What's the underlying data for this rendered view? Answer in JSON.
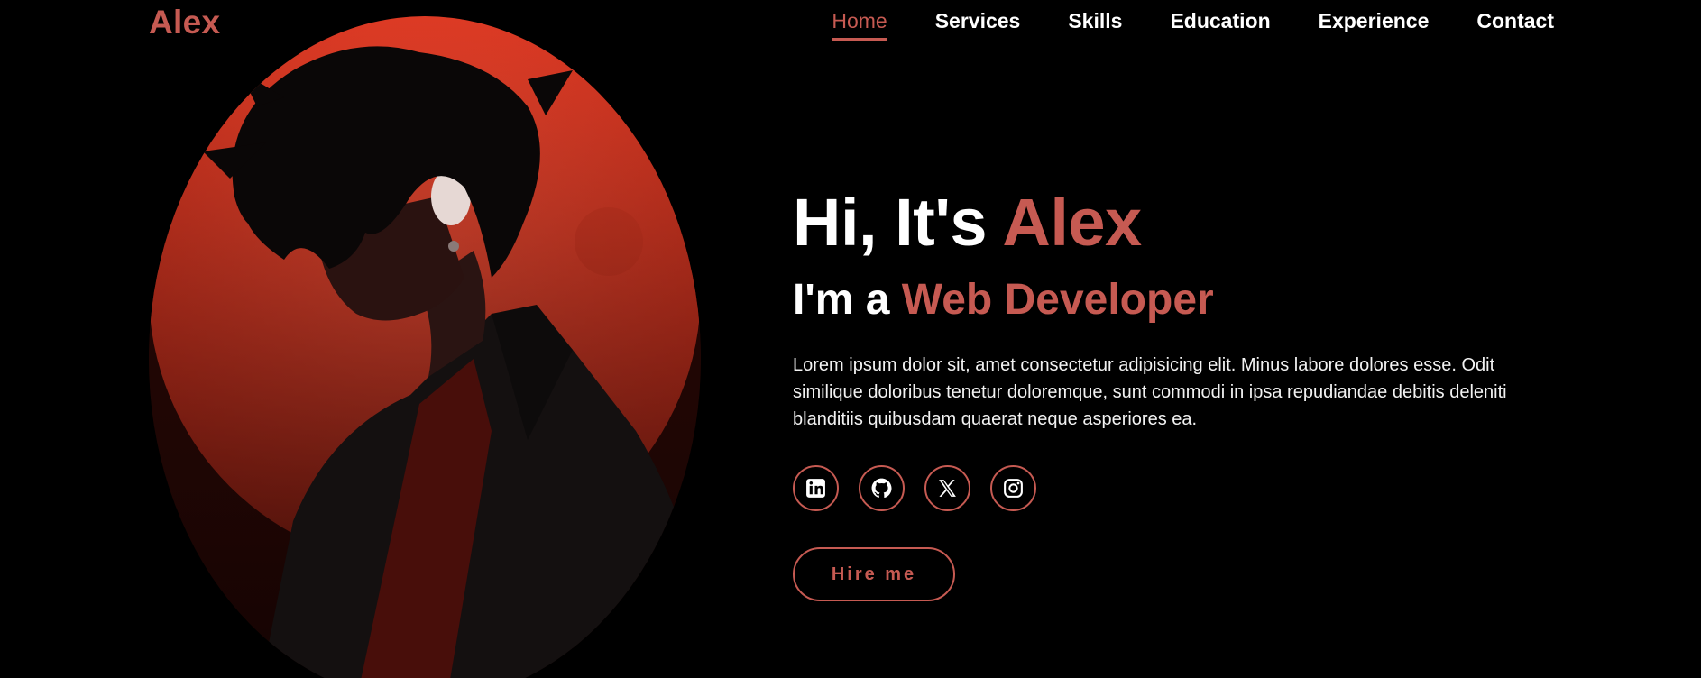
{
  "brand": {
    "logo": "Alex",
    "accent_color": "#c65a52"
  },
  "nav": {
    "items": [
      {
        "label": "Home",
        "active": true
      },
      {
        "label": "Services"
      },
      {
        "label": "Skills"
      },
      {
        "label": "Education"
      },
      {
        "label": "Experience"
      },
      {
        "label": "Contact"
      }
    ]
  },
  "hero": {
    "greeting": "Hi, It's ",
    "name": "Alex",
    "role_prefix": "I'm a ",
    "role": "Web Developer",
    "description": "Lorem ipsum dolor sit, amet consectetur adipisicing elit. Minus labore dolores esse. Odit similique doloribus tenetur doloremque, sunt commodi in ipsa repudiandae debitis deleniti blanditiis quibusdam quaerat neque asperiores ea.",
    "socials": [
      "linkedin-icon",
      "github-icon",
      "x-icon",
      "instagram-icon"
    ],
    "cta": "Hire me"
  },
  "portrait": {
    "moon_color": "#e8432c",
    "background": "#000000"
  }
}
